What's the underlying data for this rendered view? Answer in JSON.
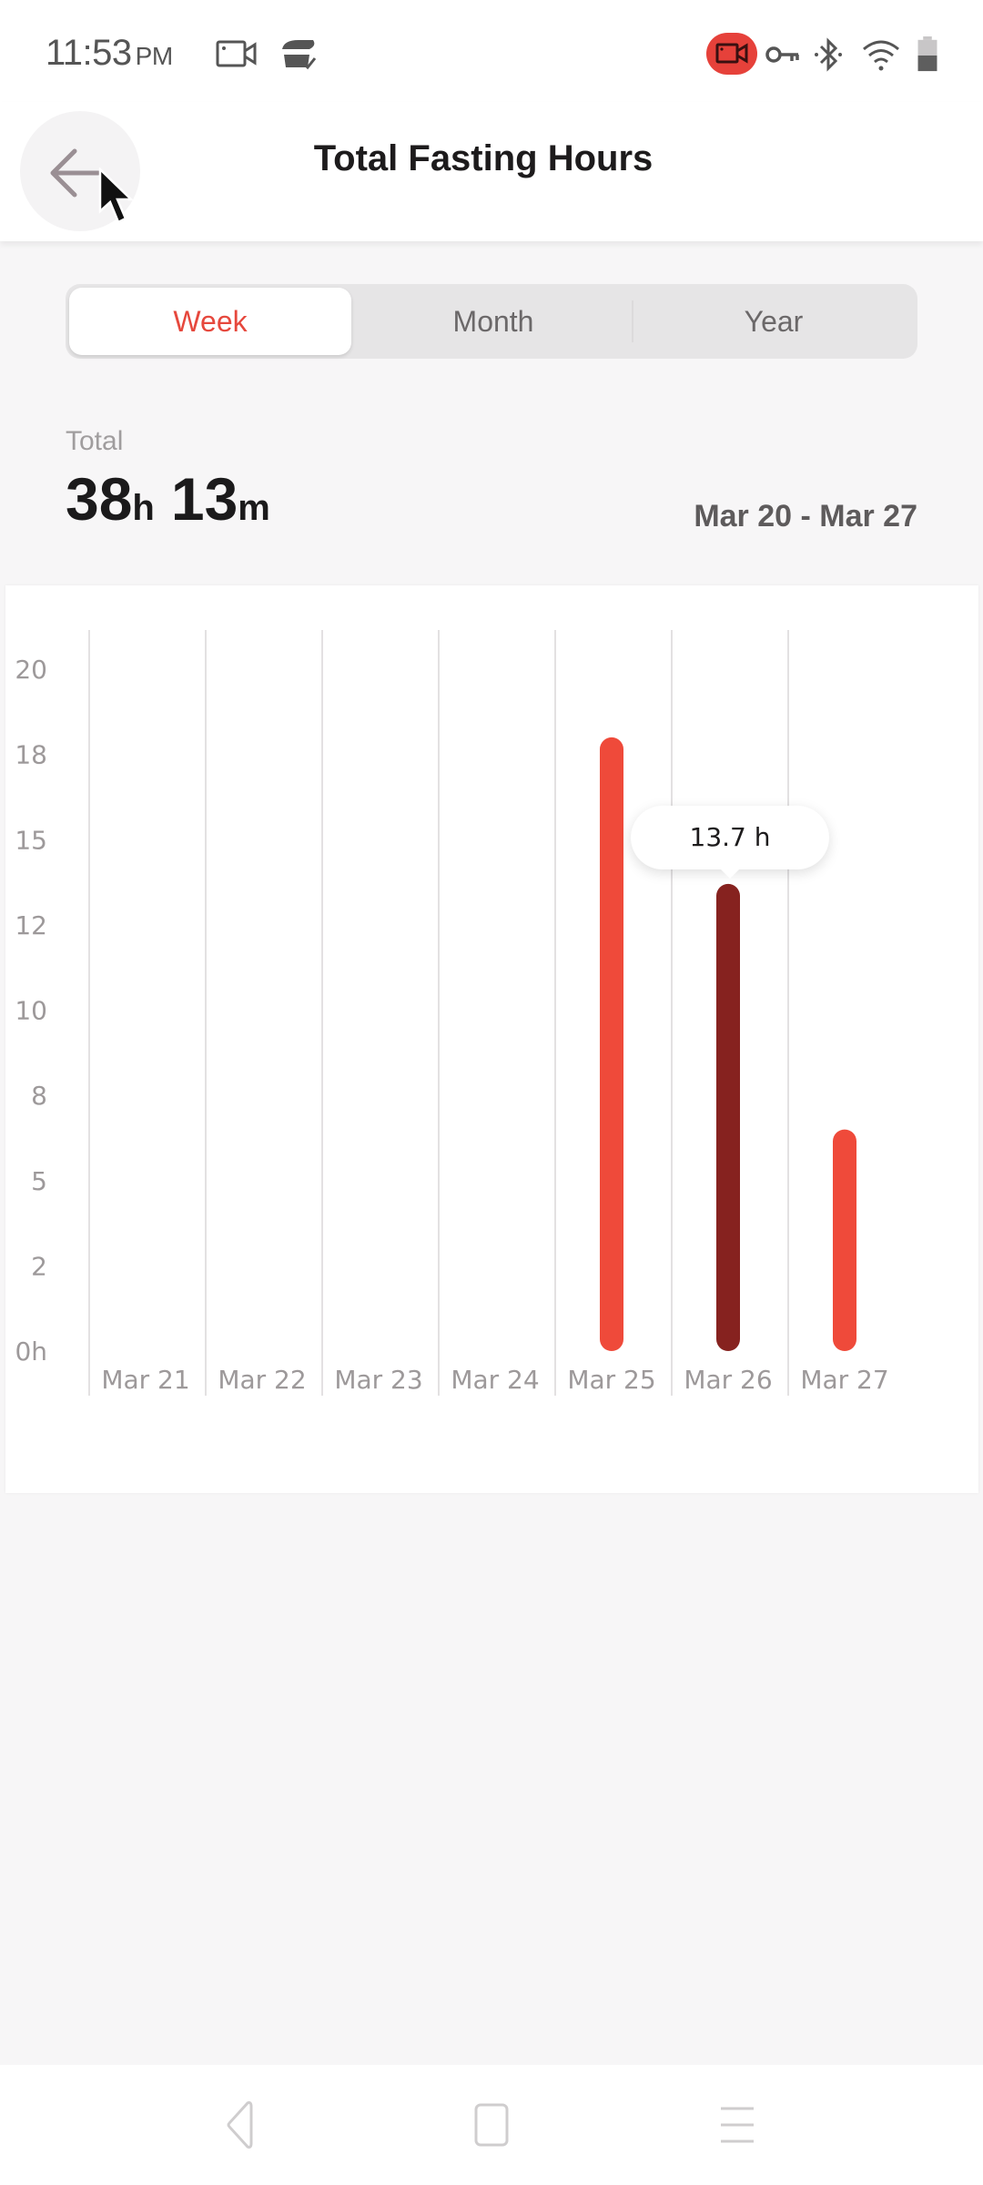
{
  "status_bar": {
    "time": "11:53",
    "ampm": "PM",
    "left_icons": [
      "screen-record-icon",
      "sync-check-icon"
    ],
    "right_icons": [
      "recording-indicator-icon",
      "vpn-key-icon",
      "bluetooth-icon",
      "wifi-icon",
      "battery-icon"
    ],
    "record_color": "#e6413a"
  },
  "app_bar": {
    "title": "Total Fasting Hours",
    "back_icon": "arrow-left-icon"
  },
  "segmented": {
    "tabs": [
      {
        "label": "Week",
        "active": true
      },
      {
        "label": "Month",
        "active": false
      },
      {
        "label": "Year",
        "active": false
      }
    ],
    "accent": "#e6483d"
  },
  "summary": {
    "label": "Total",
    "hours": "38",
    "hours_unit": "h",
    "minutes": "13",
    "minutes_unit": "m",
    "date_range": "Mar 20 - Mar 27"
  },
  "chart_data": {
    "type": "bar",
    "title": "",
    "xlabel": "",
    "ylabel": "",
    "categories": [
      "Mar 21",
      "Mar 22",
      "Mar 23",
      "Mar 24",
      "Mar 25",
      "Mar 26",
      "Mar 27"
    ],
    "values": [
      0,
      0,
      0,
      0,
      18.0,
      13.7,
      6.5
    ],
    "ylim": [
      0,
      20
    ],
    "yticks": [
      0,
      2.5,
      5,
      7.5,
      10,
      12.5,
      15,
      17.5,
      20
    ],
    "ytick_labels": [
      "0h",
      "2",
      "5",
      "8",
      "10",
      "12",
      "15",
      "18",
      "20"
    ],
    "grid": "vertical",
    "selected_index": 5,
    "tooltip": "13.7 h",
    "bar_color": "#ef4a3a",
    "selected_color": "#86221f",
    "legend": "none"
  },
  "nav_bar": {
    "buttons": [
      "back-nav-icon",
      "home-nav-icon",
      "recents-menu-icon"
    ]
  }
}
